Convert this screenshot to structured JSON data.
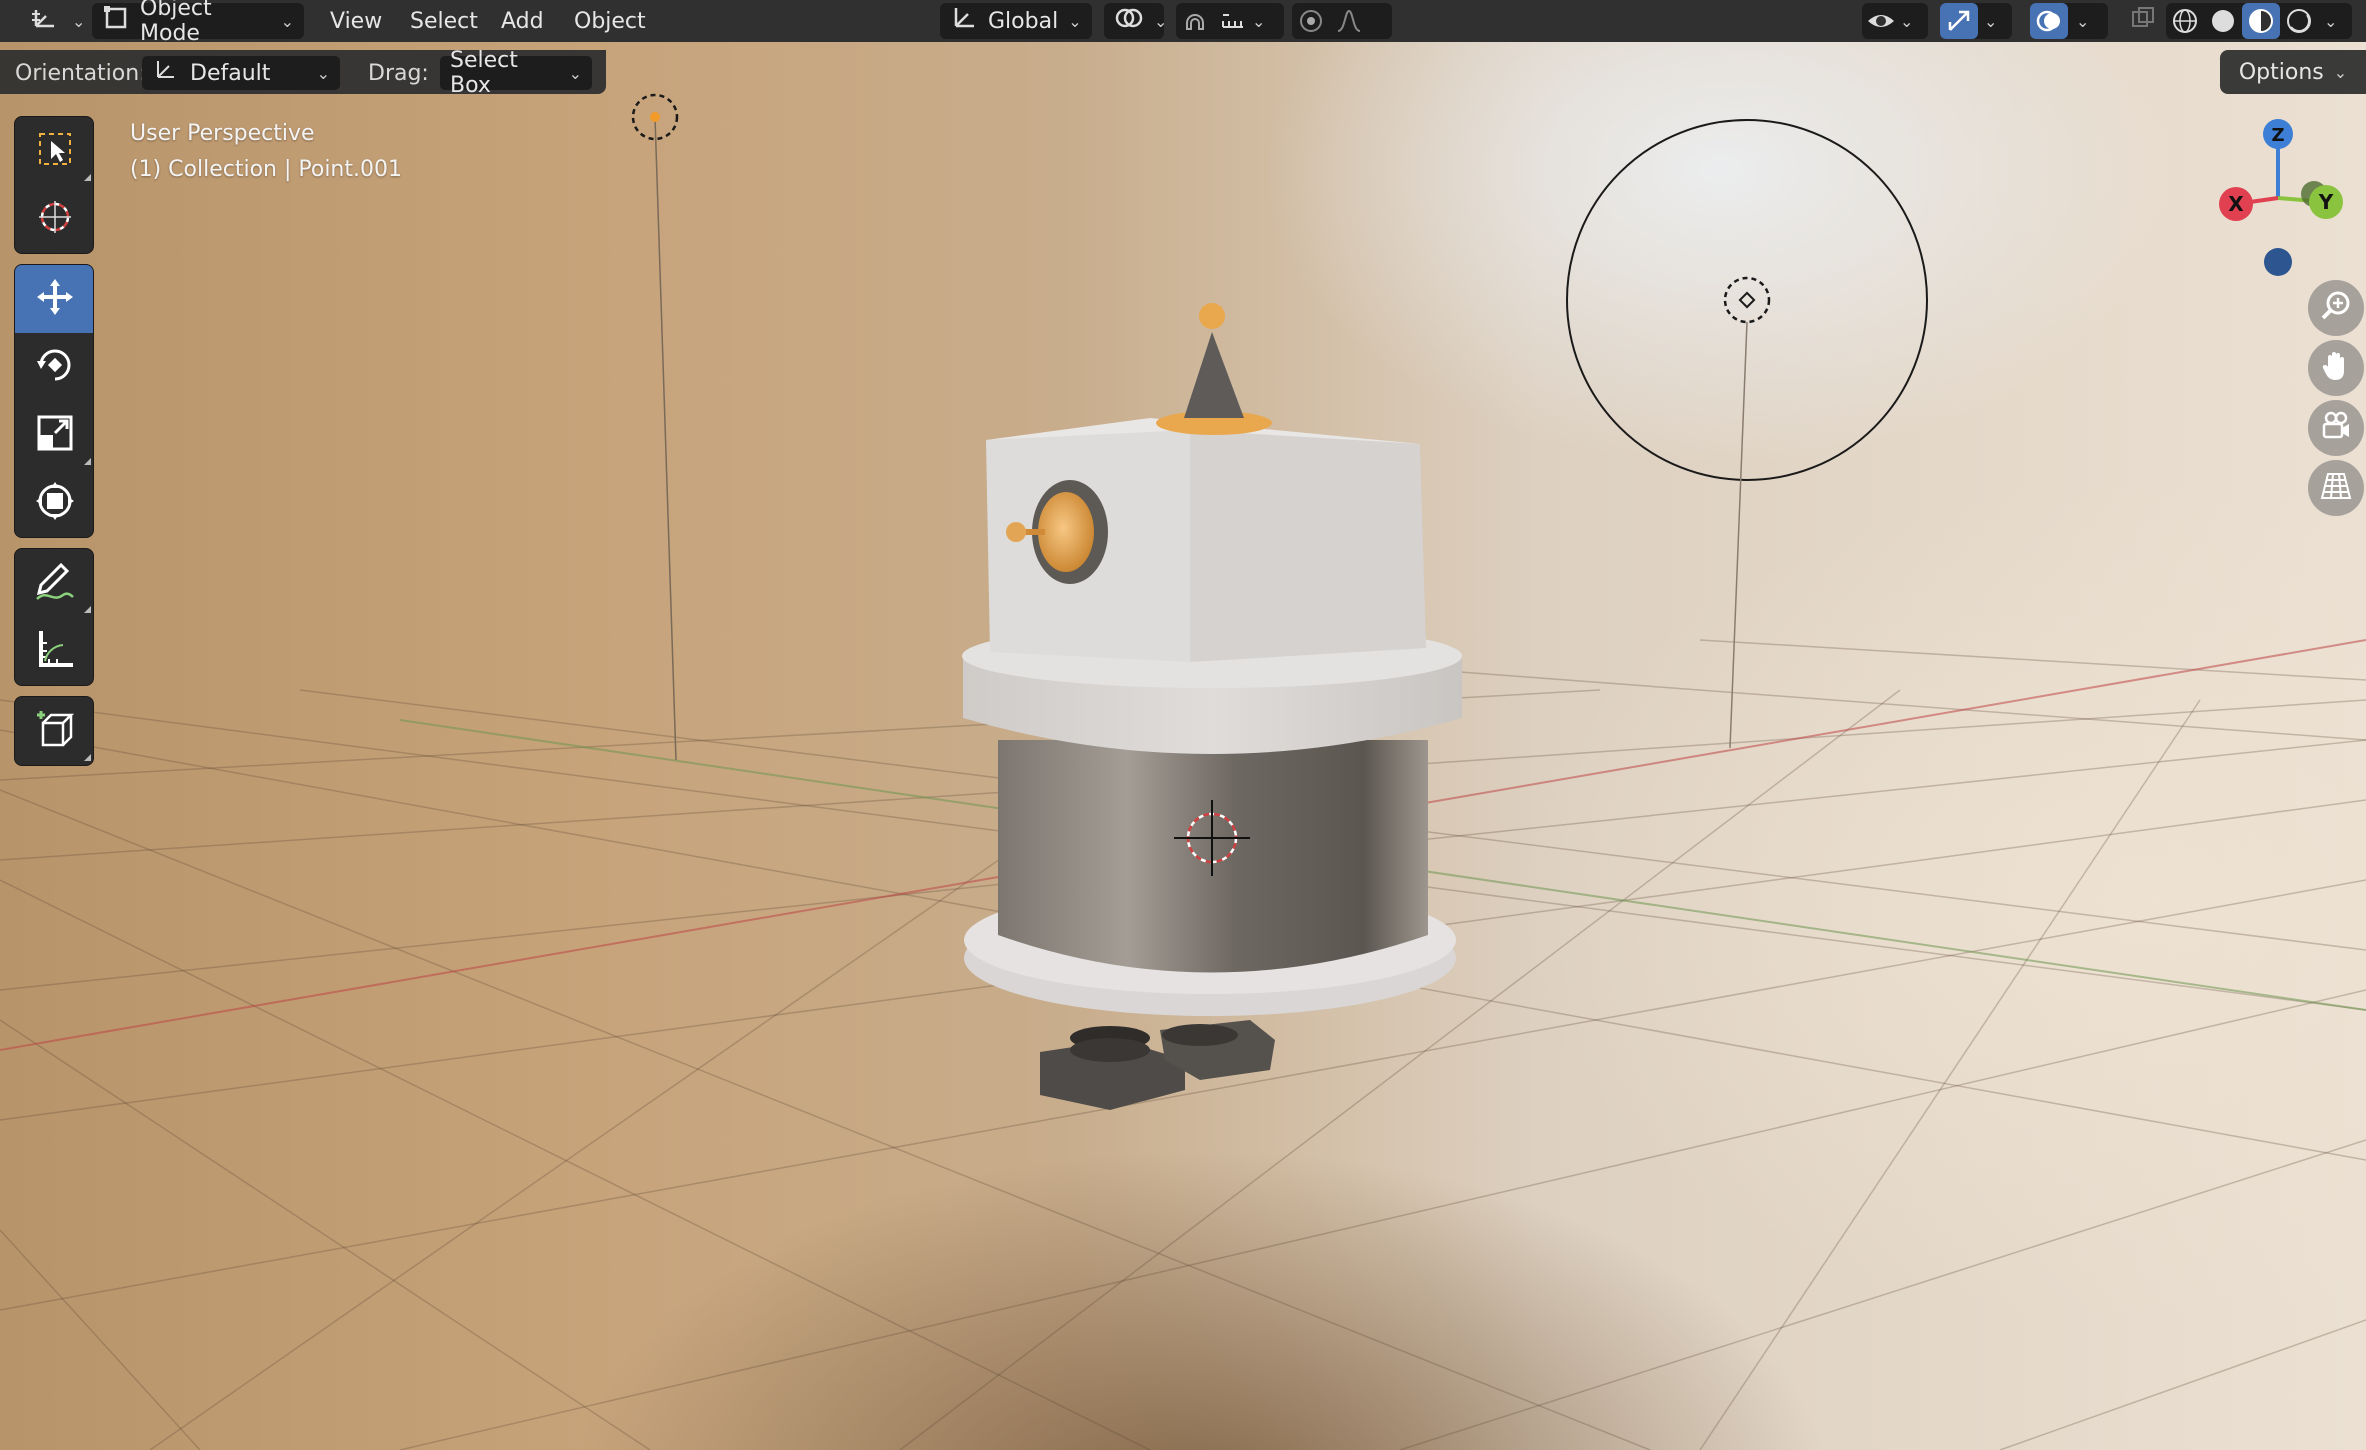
{
  "header": {
    "editor_type_icon": "axes-editor-icon",
    "mode": "Object Mode",
    "menu": [
      "View",
      "Select",
      "Add",
      "Object"
    ],
    "transform_orientation": "Global",
    "pivot_icon": "pivot-icon",
    "snap_icon": "magnet-icon",
    "proportional_icon": "proportional-edit-icon",
    "shading_modes": [
      "wireframe",
      "solid",
      "material-preview",
      "rendered"
    ],
    "active_shading": "material-preview"
  },
  "tool_settings": {
    "orientation_label": "Orientation:",
    "orientation_value": "Default",
    "drag_label": "Drag:",
    "drag_value": "Select Box",
    "options_label": "Options"
  },
  "toolbar": {
    "tools": [
      "select-box",
      "cursor",
      "move",
      "rotate",
      "scale",
      "transform",
      "annotate",
      "measure",
      "add-cube"
    ],
    "active_tool": "move"
  },
  "overlay": {
    "view_name": "User Perspective",
    "collection_info": "(1) Collection | Point.001"
  },
  "gizmo": {
    "x_label": "X",
    "y_label": "Y",
    "z_label": "Z",
    "colors": {
      "x": "#e0404f",
      "y": "#8ac33e",
      "z": "#3d7fd6"
    }
  },
  "navigation": [
    "zoom",
    "pan",
    "camera",
    "perspective-toggle"
  ],
  "colors": {
    "accent": "#4772b3",
    "header_bg": "#303030",
    "field_bg": "#1d1d1d",
    "robot_orange": "#e9a74e"
  }
}
